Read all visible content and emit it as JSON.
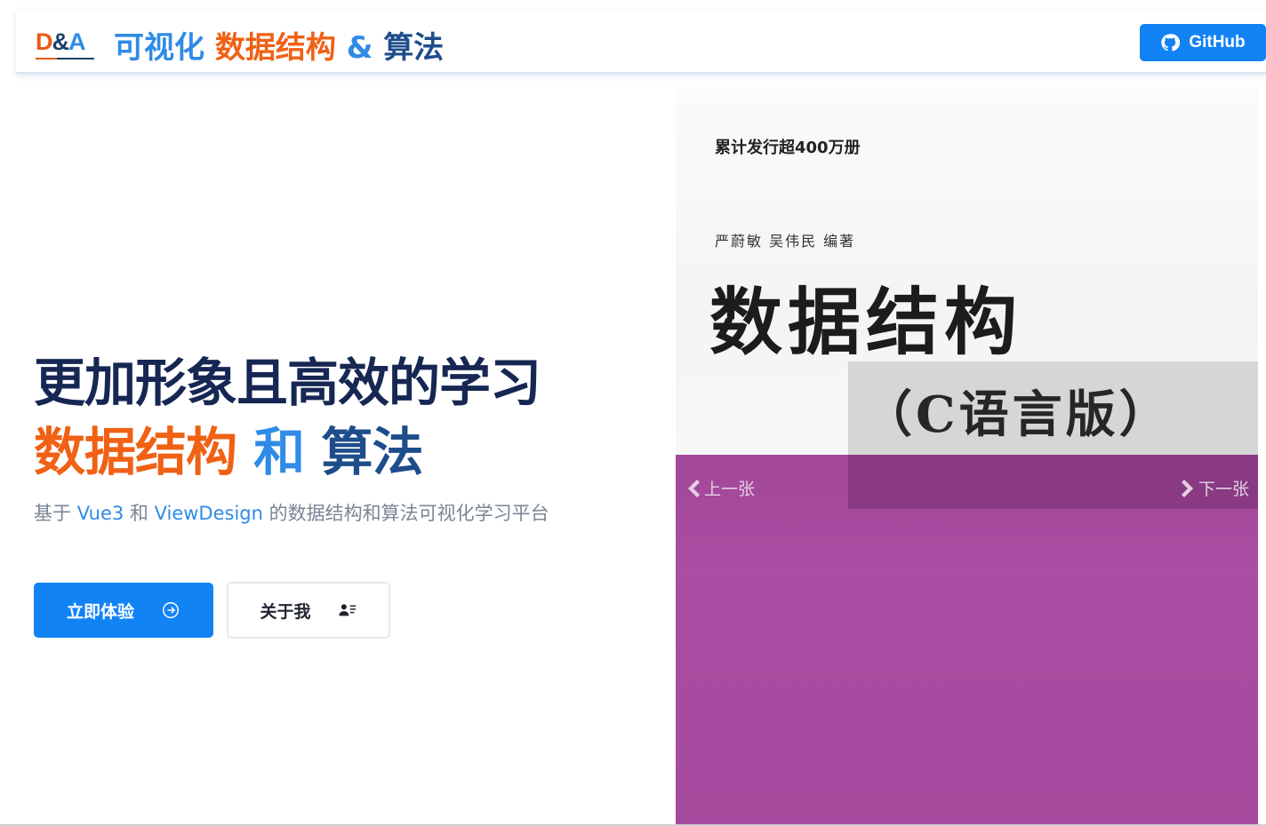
{
  "header": {
    "logo": {
      "d": "D",
      "amp": "&",
      "a": "A"
    },
    "title": {
      "part1": "可视化",
      "part2": "数据结构",
      "part3": "&",
      "part4": "算法"
    },
    "github_label": "GitHub"
  },
  "hero": {
    "headline_line1": "更加形象且高效的学习",
    "headline_line2": {
      "part1": "数据结构",
      "part2": "和",
      "part3": "算法"
    },
    "subtitle": {
      "prefix": "基于 ",
      "vue": "Vue3",
      "mid": " 和 ",
      "vd": "ViewDesign",
      "suffix": " 的数据结构和算法可视化学习平台"
    },
    "primary_button": "立即体验",
    "secondary_button": "关于我"
  },
  "carousel": {
    "cover_tag": "累计发行超400万册",
    "cover_authors": "严蔚敏 吴伟民 编著",
    "cover_title": "数据结构",
    "cover_subtitle": "（C语言版）",
    "prev_label": "上一张",
    "next_label": "下一张"
  },
  "colors": {
    "brand_blue": "#1283f5",
    "accent_orange": "#f06115",
    "light_blue": "#2f8be6",
    "navy": "#162753"
  },
  "icons": {
    "github": "github-icon",
    "arrow_circle": "arrow-right-circle-icon",
    "contact": "contact-card-icon",
    "prev": "chevron-left-icon",
    "next": "chevron-right-icon"
  }
}
